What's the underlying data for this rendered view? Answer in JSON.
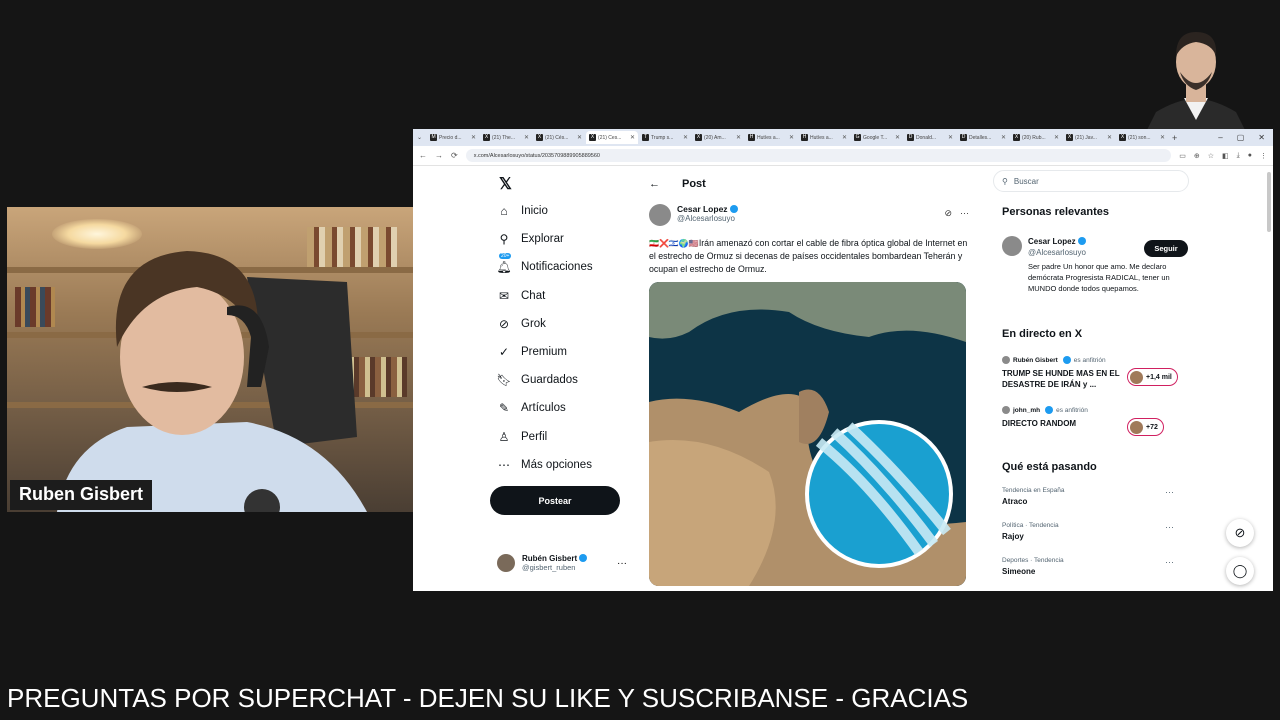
{
  "webcam": {
    "name_tag": "Ruben Gisbert"
  },
  "browser": {
    "tabs": [
      {
        "label": "Precio d...",
        "fav": "M"
      },
      {
        "label": "(21) The...",
        "fav": "X"
      },
      {
        "label": "(21) Cés...",
        "fav": "X"
      },
      {
        "label": "(21) Ces...",
        "fav": "X"
      },
      {
        "label": "Trump s...",
        "fav": "T"
      },
      {
        "label": "(20) Am...",
        "fav": "X"
      },
      {
        "label": "Hutíes a...",
        "fav": "H"
      },
      {
        "label": "Hutíes a...",
        "fav": "H"
      },
      {
        "label": "Google T...",
        "fav": "G"
      },
      {
        "label": "Donald...",
        "fav": "D"
      },
      {
        "label": "Detalles...",
        "fav": "D"
      },
      {
        "label": "(20) Rub...",
        "fav": "X"
      },
      {
        "label": "(21) Jav...",
        "fav": "X"
      },
      {
        "label": "(21) son...",
        "fav": "X"
      }
    ],
    "url": "x.com/Alcesarlosuyo/status/2035709889905889560"
  },
  "x": {
    "nav": [
      {
        "label": "Inicio",
        "icon": "home-icon"
      },
      {
        "label": "Explorar",
        "icon": "search-icon"
      },
      {
        "label": "Notificaciones",
        "icon": "bell-icon",
        "badge": "20+"
      },
      {
        "label": "Chat",
        "icon": "mail-icon"
      },
      {
        "label": "Grok",
        "icon": "grok-icon"
      },
      {
        "label": "Premium",
        "icon": "premium-icon"
      },
      {
        "label": "Guardados",
        "icon": "bookmark-icon"
      },
      {
        "label": "Artículos",
        "icon": "article-icon"
      },
      {
        "label": "Perfil",
        "icon": "user-icon"
      },
      {
        "label": "Más opciones",
        "icon": "more-icon"
      }
    ],
    "post_button": "Postear",
    "me": {
      "name": "Rubén Gisbert",
      "handle": "@gisbert_ruben"
    },
    "post": {
      "header": "Post",
      "author_name": "Cesar Lopez",
      "author_handle": "@Alcesarlosuyo",
      "text": "Irán amenazó con cortar el cable de fibra óptica global de Internet en el estrecho de Ormuz si decenas de países occidentales bombardean Teherán y ocupan el estrecho de Ormuz."
    },
    "search_placeholder": "Buscar",
    "relevant": {
      "title": "Personas relevantes",
      "name": "Cesar Lopez",
      "handle": "@Alcesarlosuyo",
      "follow": "Seguir",
      "bio": "Ser padre Un honor que amo. Me declaro demócrata Progresista RADICAL, tener un MUNDO donde todos quepamos."
    },
    "live": {
      "title": "En directo en X",
      "items": [
        {
          "host": "Rubén Gisbert",
          "role": "es anfitrión",
          "title": "TRUMP SE HUNDE MAS EN EL DESASTRE DE IRÁN y ...",
          "count": "+1,4 mil"
        },
        {
          "host": "john_mh",
          "role": "es anfitrión",
          "title": "DIRECTO RANDOM",
          "count": "+72"
        }
      ]
    },
    "trends": {
      "title": "Qué está pasando",
      "items": [
        {
          "category": "Tendencia en España",
          "name": "Atraco"
        },
        {
          "category": "Política · Tendencia",
          "name": "Rajoy"
        },
        {
          "category": "Deportes · Tendencia",
          "name": "Simeone"
        }
      ]
    }
  },
  "ticker": "PREGUNTAS POR SUPERCHAT - DEJEN SU LIKE Y SUSCRIBANSE - GRACIAS"
}
